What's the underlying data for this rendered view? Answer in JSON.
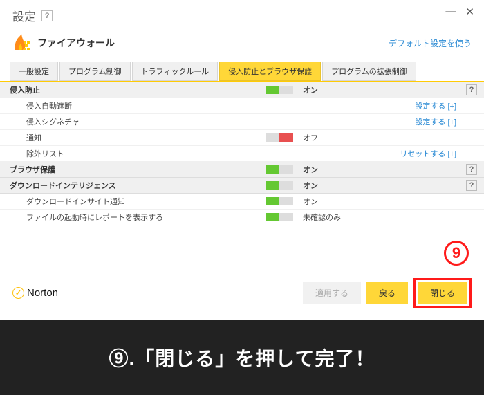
{
  "titlebar": {
    "title": "設定",
    "help": "?"
  },
  "subheader": {
    "title": "ファイアウォール",
    "default_link": "デフォルト設定を使う"
  },
  "tabs": {
    "items": [
      {
        "label": "一般設定"
      },
      {
        "label": "プログラム制御"
      },
      {
        "label": "トラフィックルール"
      },
      {
        "label": "侵入防止とブラウザ保護"
      },
      {
        "label": "プログラムの拡張制御"
      }
    ]
  },
  "sections": {
    "intrusion": {
      "header": "侵入防止",
      "status": "オン",
      "help": "?",
      "rows": [
        {
          "label": "侵入自動遮断",
          "action": "設定する [+]"
        },
        {
          "label": "侵入シグネチャ",
          "action": "設定する [+]"
        },
        {
          "label": "通知",
          "status": "オフ"
        },
        {
          "label": "除外リスト",
          "action": "リセットする [+]"
        }
      ]
    },
    "browser": {
      "header": "ブラウザ保護",
      "status": "オン",
      "help": "?"
    },
    "download": {
      "header": "ダウンロードインテリジェンス",
      "status": "オン",
      "help": "?",
      "rows": [
        {
          "label": "ダウンロードインサイト通知",
          "status": "オン"
        },
        {
          "label": "ファイルの起動時にレポートを表示する",
          "status": "未確認のみ"
        }
      ]
    }
  },
  "footer": {
    "brand": "Norton",
    "apply": "適用する",
    "back": "戻る",
    "close": "閉じる"
  },
  "annotation": {
    "step": "9",
    "caption": "⑨.「閉じる」を押して完了！"
  }
}
